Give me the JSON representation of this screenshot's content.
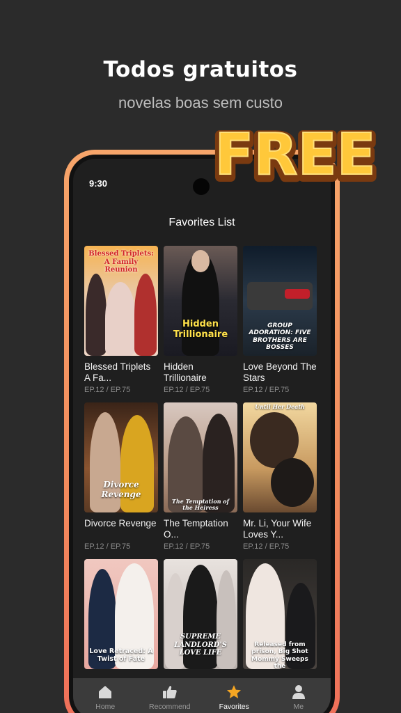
{
  "promo": {
    "headline": "Todos gratuitos",
    "subheadline": "novelas boas sem custo",
    "badge": "FREE"
  },
  "status_bar": {
    "time": "9:30"
  },
  "screen": {
    "title": "Favorites List"
  },
  "dramas": [
    {
      "title": "Blessed Triplets A Fa...",
      "episodes": "EP.12 / EP.75",
      "poster_text": "Blessed Triplets: A Family Reunion"
    },
    {
      "title": "Hidden Trillionaire",
      "episodes": "EP.12 / EP.75",
      "poster_text": "Hidden Trillionaire"
    },
    {
      "title": "Love Beyond The Stars",
      "episodes": "EP.12 / EP.75",
      "poster_text": "GROUP ADORATION: FIVE BROTHERS ARE BOSSES"
    },
    {
      "title": "Divorce Revenge",
      "episodes": "EP.12 / EP.75",
      "poster_text": "Divorce Revenge"
    },
    {
      "title": "The Temptation O...",
      "episodes": "EP.12 / EP.75",
      "poster_text": "The Temptation of the Heiress"
    },
    {
      "title": "Mr. Li, Your Wife Loves Y...",
      "episodes": "EP.12 / EP.75",
      "poster_text": "Until Her Death"
    },
    {
      "title": "",
      "episodes": "",
      "poster_text": "Love Retraced: A Twist of Fate"
    },
    {
      "title": "",
      "episodes": "",
      "poster_text": "SUPREME LANDLORD'S LOVE LIFE"
    },
    {
      "title": "",
      "episodes": "",
      "poster_text": "Released from prison, Big Shot Mommy Sweeps the"
    }
  ],
  "tabs": [
    {
      "label": "Home",
      "icon": "home-icon",
      "active": false
    },
    {
      "label": "Recommend",
      "icon": "thumbs-up-icon",
      "active": false
    },
    {
      "label": "Favorites",
      "icon": "star-icon",
      "active": true
    },
    {
      "label": "Me",
      "icon": "person-icon",
      "active": false
    }
  ],
  "colors": {
    "background": "#2b2b2b",
    "phone_frame": "#f28a5c",
    "accent": "#f5a623",
    "badge_fill": "#ffc83a"
  }
}
